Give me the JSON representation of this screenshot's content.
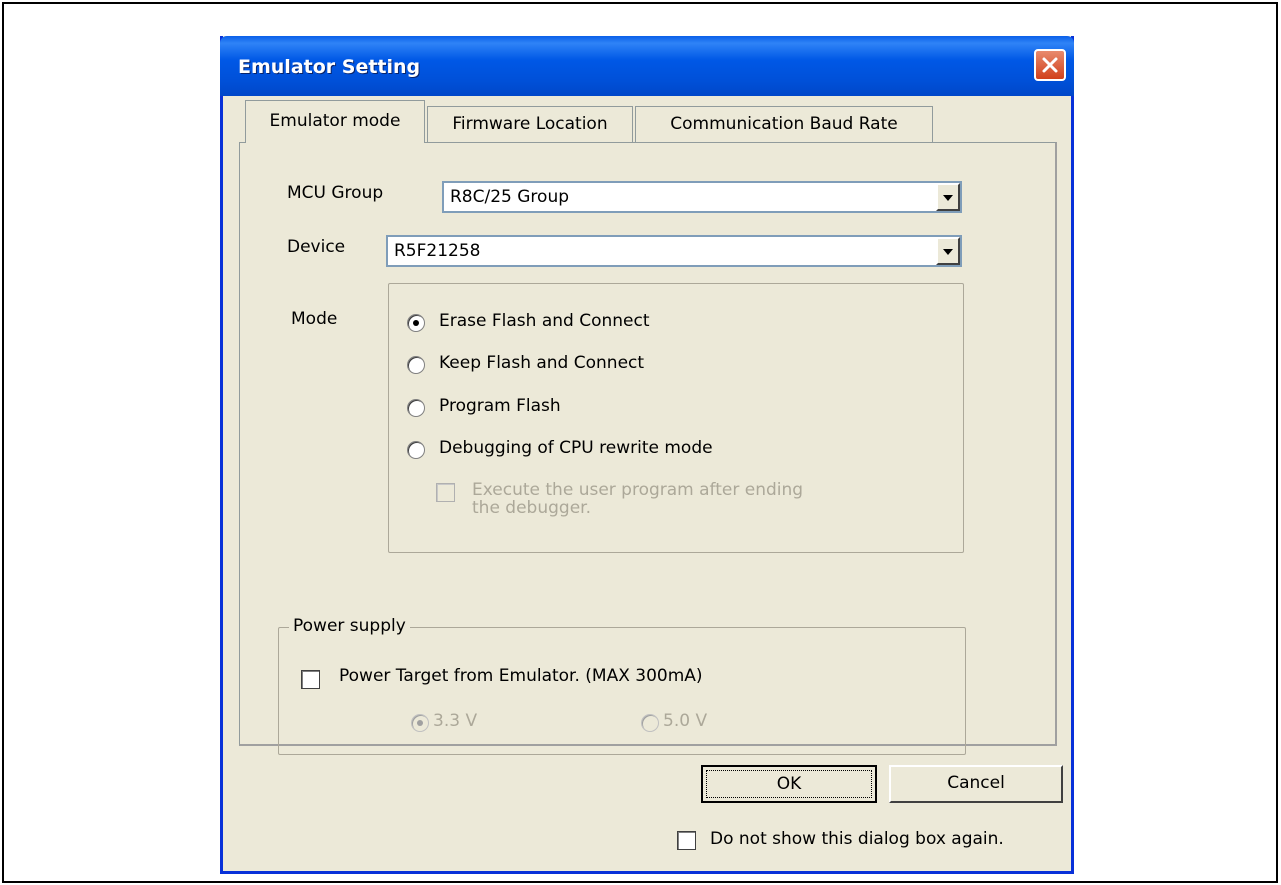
{
  "window": {
    "title": "Emulator Setting",
    "accent_color": "#0058e6",
    "close_icon": "close-icon"
  },
  "tabs": [
    {
      "label": "Emulator mode",
      "active": true
    },
    {
      "label": "Firmware Location",
      "active": false
    },
    {
      "label": "Communication Baud Rate",
      "active": false
    }
  ],
  "mcu_group": {
    "label": "MCU Group",
    "value": "R8C/25 Group"
  },
  "device": {
    "label": "Device",
    "value": "R5F21258"
  },
  "mode": {
    "label": "Mode",
    "options": [
      {
        "label": "Erase Flash and Connect",
        "checked": true
      },
      {
        "label": "Keep Flash and Connect",
        "checked": false
      },
      {
        "label": "Program Flash",
        "checked": false
      },
      {
        "label": "Debugging of CPU rewrite mode",
        "checked": false
      }
    ],
    "execute_checkbox": {
      "line1": "Execute the user program after ending",
      "line2": "the debugger.",
      "checked": false,
      "enabled": false
    }
  },
  "power_supply": {
    "title": "Power supply",
    "checkbox_label": "Power Target from Emulator. (MAX 300mA)",
    "checked": false,
    "voltages": [
      {
        "label": "3.3 V",
        "checked": true,
        "enabled": false
      },
      {
        "label": "5.0 V",
        "checked": false,
        "enabled": false
      }
    ]
  },
  "buttons": {
    "ok": "OK",
    "cancel": "Cancel"
  },
  "footer": {
    "dont_show_label": "Do not show this dialog box again.",
    "checked": false
  }
}
